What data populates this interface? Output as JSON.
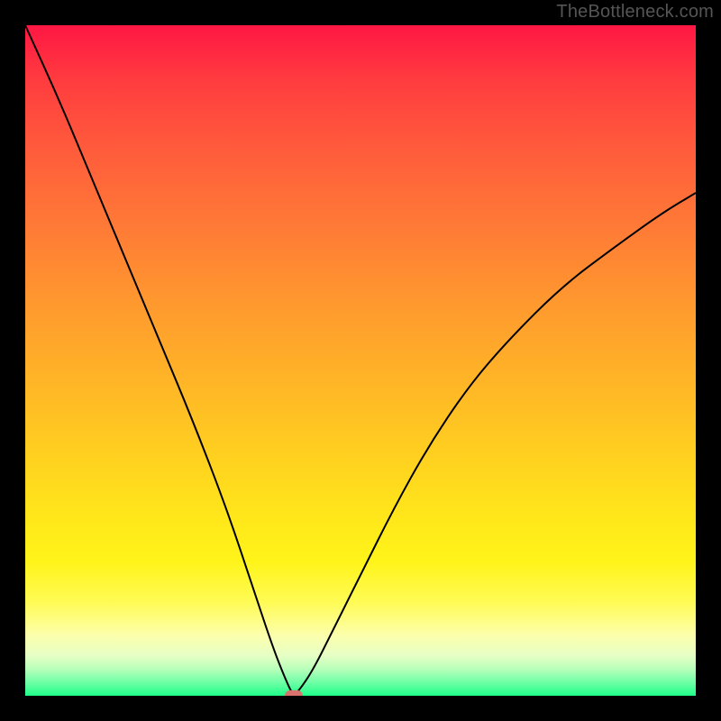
{
  "watermark": "TheBottleneck.com",
  "colors": {
    "page_bg": "#000000",
    "curve": "#000000",
    "marker": "#d9726e",
    "gradient_top": "#ff1744",
    "gradient_bottom": "#1eff88"
  },
  "chart_data": {
    "type": "line",
    "title": "",
    "xlabel": "",
    "ylabel": "",
    "xlim": [
      0,
      100
    ],
    "ylim": [
      0,
      100
    ],
    "grid": false,
    "note": "Values are estimated from the rendered curve. The plot background is a vertical color gradient from red (top, high bottleneck) to green (bottom, low bottleneck). The black curve is V-shaped with its minimum near x≈40 where a small rounded marker sits on the baseline.",
    "series": [
      {
        "name": "bottleneck-curve",
        "x": [
          0,
          5,
          10,
          15,
          20,
          25,
          30,
          34,
          37,
          39,
          40,
          41,
          43,
          46,
          50,
          55,
          60,
          66,
          72,
          80,
          88,
          95,
          100
        ],
        "y": [
          100,
          89,
          77,
          65,
          53,
          41,
          28,
          16,
          7,
          2,
          0,
          1,
          4,
          10,
          18,
          28,
          37,
          46,
          53,
          61,
          67,
          72,
          75
        ]
      }
    ],
    "marker": {
      "x": 40,
      "y": 0
    }
  }
}
